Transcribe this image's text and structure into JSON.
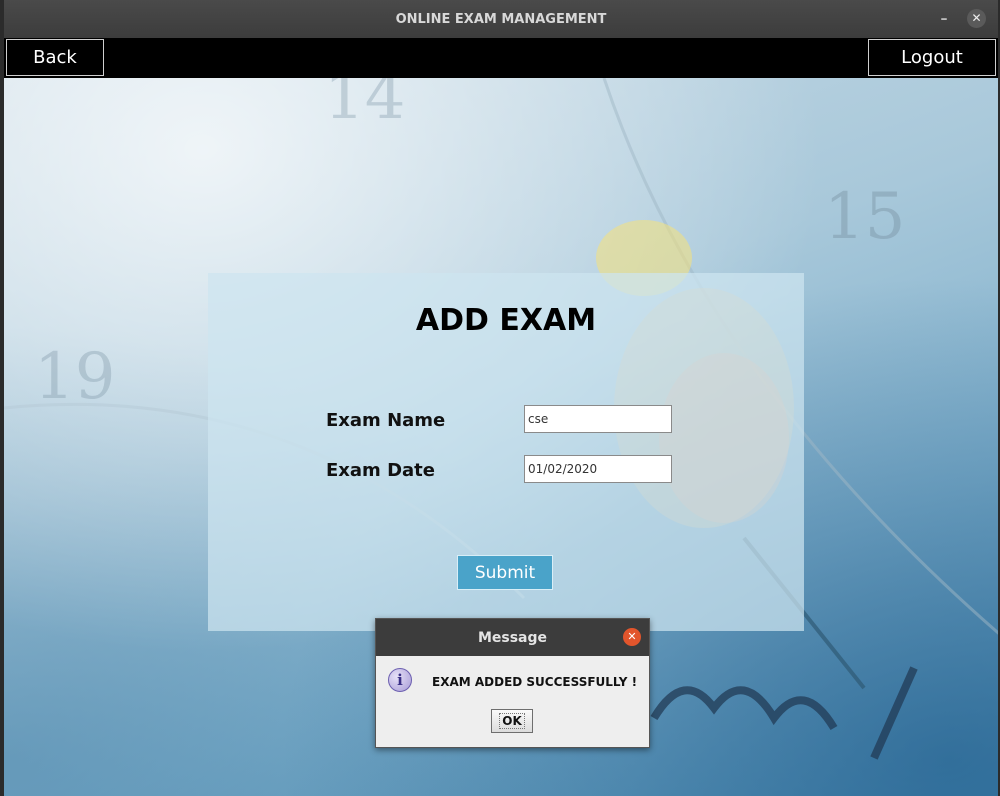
{
  "window": {
    "title": "ONLINE EXAM MANAGEMENT",
    "minimize_glyph": "–",
    "close_glyph": "✕"
  },
  "toolbar": {
    "back_label": "Back",
    "logout_label": "Logout"
  },
  "form": {
    "title": "ADD EXAM",
    "exam_name_label": "Exam Name",
    "exam_name_value": "cse",
    "exam_date_label": "Exam Date",
    "exam_date_value": "01/02/2020",
    "submit_label": "Submit"
  },
  "dialog": {
    "title": "Message",
    "message": "EXAM ADDED SUCCESSFULLY !",
    "ok_label": "OK",
    "icon": "info-icon",
    "close_glyph": "✕"
  },
  "colors": {
    "toolbar_bg": "#000000",
    "submit_bg": "#4aa3c9",
    "dialog_close": "#e2552c"
  }
}
